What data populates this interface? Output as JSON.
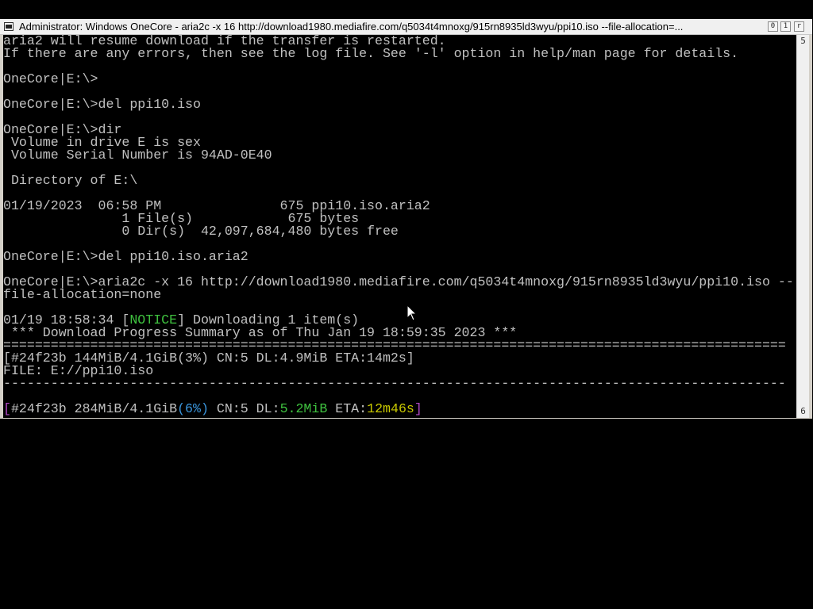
{
  "window": {
    "title": "Administrator:  Windows OneCore - aria2c  -x 16 http://download1980.mediafire.com/q5034t4mnoxg/915rn8935ld3wyu/ppi10.iso --file-allocation=...",
    "buttons": {
      "minimize": "0",
      "maximize": "1",
      "close": "r"
    },
    "scrollbar": {
      "up": "5",
      "down": "6"
    }
  },
  "console": {
    "lines": [
      "aria2 will resume download if the transfer is restarted.",
      "If there are any errors, then see the log file. See '-l' option in help/man page for details.",
      "",
      "OneCore|E:\\>",
      "",
      "OneCore|E:\\>del ppi10.iso",
      "",
      "OneCore|E:\\>dir",
      " Volume in drive E is sex",
      " Volume Serial Number is 94AD-0E40",
      "",
      " Directory of E:\\",
      "",
      "01/19/2023  06:58 PM               675 ppi10.iso.aria2",
      "               1 File(s)            675 bytes",
      "               0 Dir(s)  42,097,684,480 bytes free",
      "",
      "OneCore|E:\\>del ppi10.iso.aria2",
      "",
      "OneCore|E:\\>aria2c -x 16 http://download1980.mediafire.com/q5034t4mnoxg/915rn8935ld3wyu/ppi10.iso --",
      "file-allocation=none",
      "",
      "",
      " *** Download Progress Summary as of Thu Jan 19 18:59:35 2023 ***",
      "===================================================================================================",
      "[#24f23b 144MiB/4.1GiB(3%) CN:5 DL:4.9MiB ETA:14m2s]",
      "FILE: E://ppi10.iso",
      "---------------------------------------------------------------------------------------------------"
    ],
    "notice": {
      "timestamp": "01/19 18:58:34 ",
      "open_bracket": "[",
      "tag": "NOTICE",
      "close_bracket": "]",
      "message": " Downloading 1 item(s)"
    },
    "progress": {
      "open_bracket": "[",
      "id_size": "#24f23b 284MiB/4.1GiB",
      "percent": "(6%)",
      "cn": " CN:5 DL:",
      "speed": "5.2MiB",
      "eta_label": " ETA:",
      "eta": "12m46s",
      "close_bracket": "]"
    }
  }
}
